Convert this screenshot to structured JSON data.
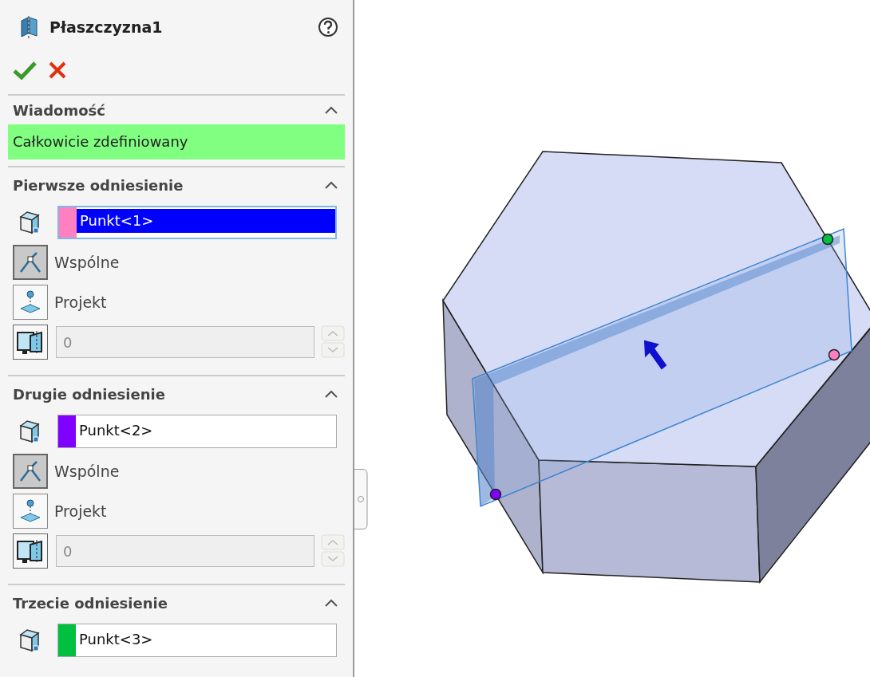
{
  "title": "Płaszczyzna1",
  "message": {
    "heading": "Wiadomość",
    "text": "Całkowicie zdefiniowany",
    "expanded": true
  },
  "references": [
    {
      "heading": "Pierwsze odniesienie",
      "expanded": true,
      "color": "#ff80c0",
      "value": "Punkt<1>",
      "selected": true,
      "options": [
        {
          "kind": "coincident",
          "label": "Wspólne",
          "selected": true
        },
        {
          "kind": "project",
          "label": "Projekt",
          "selected": false
        }
      ],
      "offset": {
        "value": "0",
        "disabled": true
      }
    },
    {
      "heading": "Drugie odniesienie",
      "expanded": true,
      "color": "#8000ff",
      "value": "Punkt<2>",
      "selected": false,
      "options": [
        {
          "kind": "coincident",
          "label": "Wspólne",
          "selected": true
        },
        {
          "kind": "project",
          "label": "Projekt",
          "selected": false
        }
      ],
      "offset": {
        "value": "0",
        "disabled": true
      }
    },
    {
      "heading": "Trzecie odniesienie",
      "expanded": true,
      "color": "#00c040",
      "value": "Punkt<3>",
      "selected": false
    }
  ]
}
